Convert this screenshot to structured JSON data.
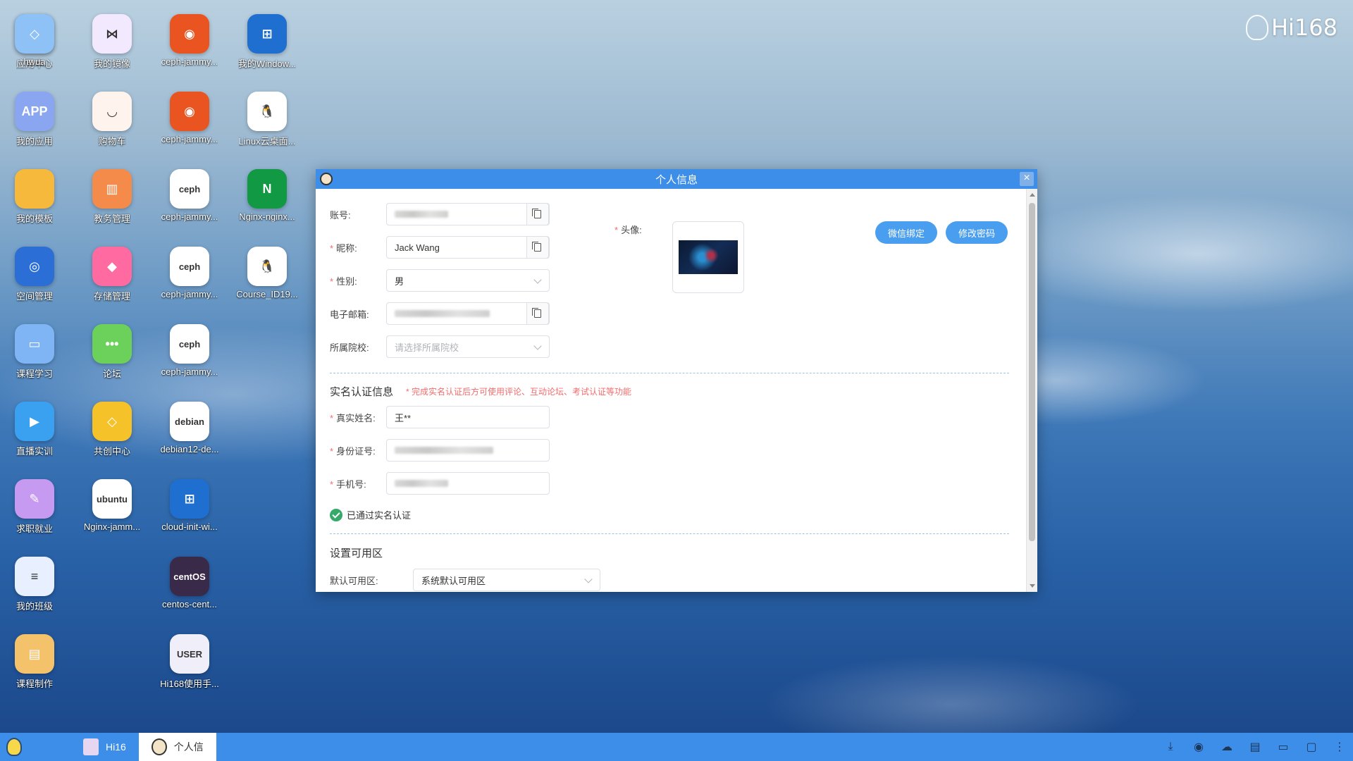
{
  "brand": "Hi168",
  "desktop_icons": [
    {
      "label": "应用中心",
      "icon": "app-center-icon",
      "bg": "#2f8fe8",
      "glyph": "U"
    },
    {
      "label": "我的应用",
      "icon": "my-apps-icon",
      "bg": "#8aa6f0",
      "glyph": "APP"
    },
    {
      "label": "我的模板",
      "icon": "folder-icon",
      "bg": "#f6b93b",
      "glyph": ""
    },
    {
      "label": "空间管理",
      "icon": "space-icon",
      "bg": "#2b6fd6",
      "glyph": "◎"
    },
    {
      "label": "课程学习",
      "icon": "course-study-icon",
      "bg": "#7fb5f5",
      "glyph": "▭"
    },
    {
      "label": "直播实训",
      "icon": "live-icon",
      "bg": "#3aa0f0",
      "glyph": "▶"
    },
    {
      "label": "求职就业",
      "icon": "key-icon",
      "bg": "#c59af0",
      "glyph": "✎"
    },
    {
      "label": "我的班级",
      "icon": "class-icon",
      "bg": "#e8f0ff",
      "glyph": "≡"
    },
    {
      "label": "课程制作",
      "icon": "course-make-icon",
      "bg": "#f4c26b",
      "glyph": "▤"
    },
    {
      "label": "我的镜像",
      "icon": "mirror-icon",
      "bg": "#f3e9ff",
      "glyph": "⋈"
    },
    {
      "label": "购物车",
      "icon": "cart-icon",
      "bg": "#fff3ee",
      "glyph": "◡"
    },
    {
      "label": "教务管理",
      "icon": "admin-icon",
      "bg": "#f58b4a",
      "glyph": "▥"
    },
    {
      "label": "存储管理",
      "icon": "storage-icon",
      "bg": "#ff6aa0",
      "glyph": "◆"
    },
    {
      "label": "论坛",
      "icon": "forum-icon",
      "bg": "#6cd15a",
      "glyph": "•••"
    },
    {
      "label": "共创中心",
      "icon": "cocreate-icon",
      "bg": "#f5c22a",
      "glyph": "◇"
    },
    {
      "label": "Nginx-jamm...",
      "icon": "ubuntu-icon",
      "bg": "#ffffff",
      "glyph": "ubuntu"
    },
    {
      "label": "ceph-jammy...",
      "icon": "ubuntu-icon",
      "bg": "#e95420",
      "glyph": "◉"
    },
    {
      "label": "ceph-jammy...",
      "icon": "ubuntu-icon",
      "bg": "#e95420",
      "glyph": "◉"
    },
    {
      "label": "ceph-jammy...",
      "icon": "ceph-icon",
      "bg": "#ffffff",
      "glyph": "ceph"
    },
    {
      "label": "ceph-jammy...",
      "icon": "ceph-icon",
      "bg": "#ffffff",
      "glyph": "ceph"
    },
    {
      "label": "ceph-jammy...",
      "icon": "ceph-icon",
      "bg": "#ffffff",
      "glyph": "ceph"
    },
    {
      "label": "debian12-de...",
      "icon": "debian-icon",
      "bg": "#ffffff",
      "glyph": "debian"
    },
    {
      "label": "cloud-init-wi...",
      "icon": "windows-icon",
      "bg": "#1f6fd0",
      "glyph": "⊞"
    },
    {
      "label": "centos-cent...",
      "icon": "centos-icon",
      "bg": "#3a2a4a",
      "glyph": "centOS"
    },
    {
      "label": "Hi168使用手...",
      "icon": "manual-icon",
      "bg": "#f0eef8",
      "glyph": "USER"
    },
    {
      "label": "我的Window...",
      "icon": "windows-icon",
      "bg": "#1f6fd0",
      "glyph": "⊞"
    },
    {
      "label": "Linux云桌面...",
      "icon": "linux-icon",
      "bg": "#ffffff",
      "glyph": "🐧"
    },
    {
      "label": "Nginx-nginx...",
      "icon": "nginx-icon",
      "bg": "#119a43",
      "glyph": "N"
    },
    {
      "label": "Course_ID19...",
      "icon": "linux-icon",
      "bg": "#ffffff",
      "glyph": "🐧"
    },
    {
      "label": "hwua",
      "icon": "hwua-icon",
      "bg": "#8ec1f5",
      "glyph": "◇"
    }
  ],
  "window": {
    "title": "个人信息",
    "close": "×"
  },
  "form": {
    "account_label": "账号:",
    "account_value": "",
    "nickname_label": "昵称:",
    "nickname_value": "Jack Wang",
    "gender_label": "性别:",
    "gender_value": "男",
    "email_label": "电子邮箱:",
    "school_label": "所属院校:",
    "school_placeholder": "请选择所属院校",
    "avatar_label": "头像:",
    "wechat_button": "微信绑定",
    "password_button": "修改密码"
  },
  "realname": {
    "title": "实名认证信息",
    "notice": "* 完成实名认证后方可使用评论、互动论坛、考试认证等功能",
    "name_label": "真实姓名:",
    "name_value": "王**",
    "id_label": "身份证号:",
    "phone_label": "手机号:",
    "verified_text": "已通过实名认证"
  },
  "zone": {
    "title": "设置可用区",
    "default_label": "默认可用区:",
    "default_value": "系统默认可用区"
  },
  "taskbar": {
    "items": [
      {
        "label": "Hi16",
        "active": false
      },
      {
        "label": "个人信",
        "active": true
      }
    ],
    "tray_icons": [
      "download-icon",
      "hotspot-icon",
      "wechat-icon",
      "notes-icon",
      "chat-icon",
      "monitor-icon",
      "more-icon"
    ]
  }
}
